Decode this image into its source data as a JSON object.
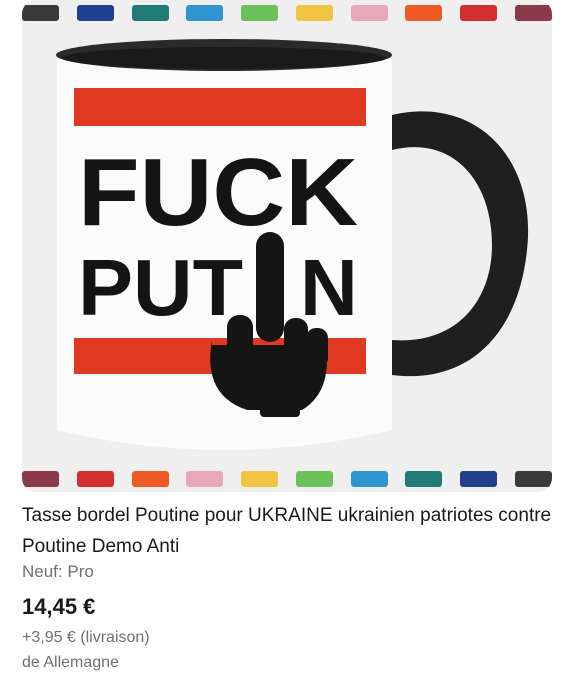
{
  "listing": {
    "title": "Tasse bordel Poutine pour UKRAINE ukrainien patriotes contre Poutine Demo Anti",
    "condition": "Neuf: Pro",
    "price": "14,45 €",
    "shipping": "+3,95 € (livraison)",
    "origin": "de Allemagne"
  },
  "product_image": {
    "mug_text_line1": "FUCK",
    "mug_text_line2": "PUT",
    "mug_text_line2_end": "N",
    "handle_color": "#1f1f1f",
    "stripe_color": "#e03a22",
    "icon": "middle-finger-icon"
  },
  "color_swatches_top": [
    "#3a3a3a",
    "#1f3f8f",
    "#1f7b73",
    "#2f95d0",
    "#6cc25a",
    "#f0c340",
    "#e9a8b8",
    "#ee5a23",
    "#d32f2f",
    "#8b3a4a"
  ],
  "color_swatches_bottom": [
    "#8b3a4a",
    "#d32f2f",
    "#ee5a23",
    "#e9a8b8",
    "#f0c340",
    "#6cc25a",
    "#2f95d0",
    "#1f7b73",
    "#1f3f8f",
    "#3a3a3a"
  ]
}
